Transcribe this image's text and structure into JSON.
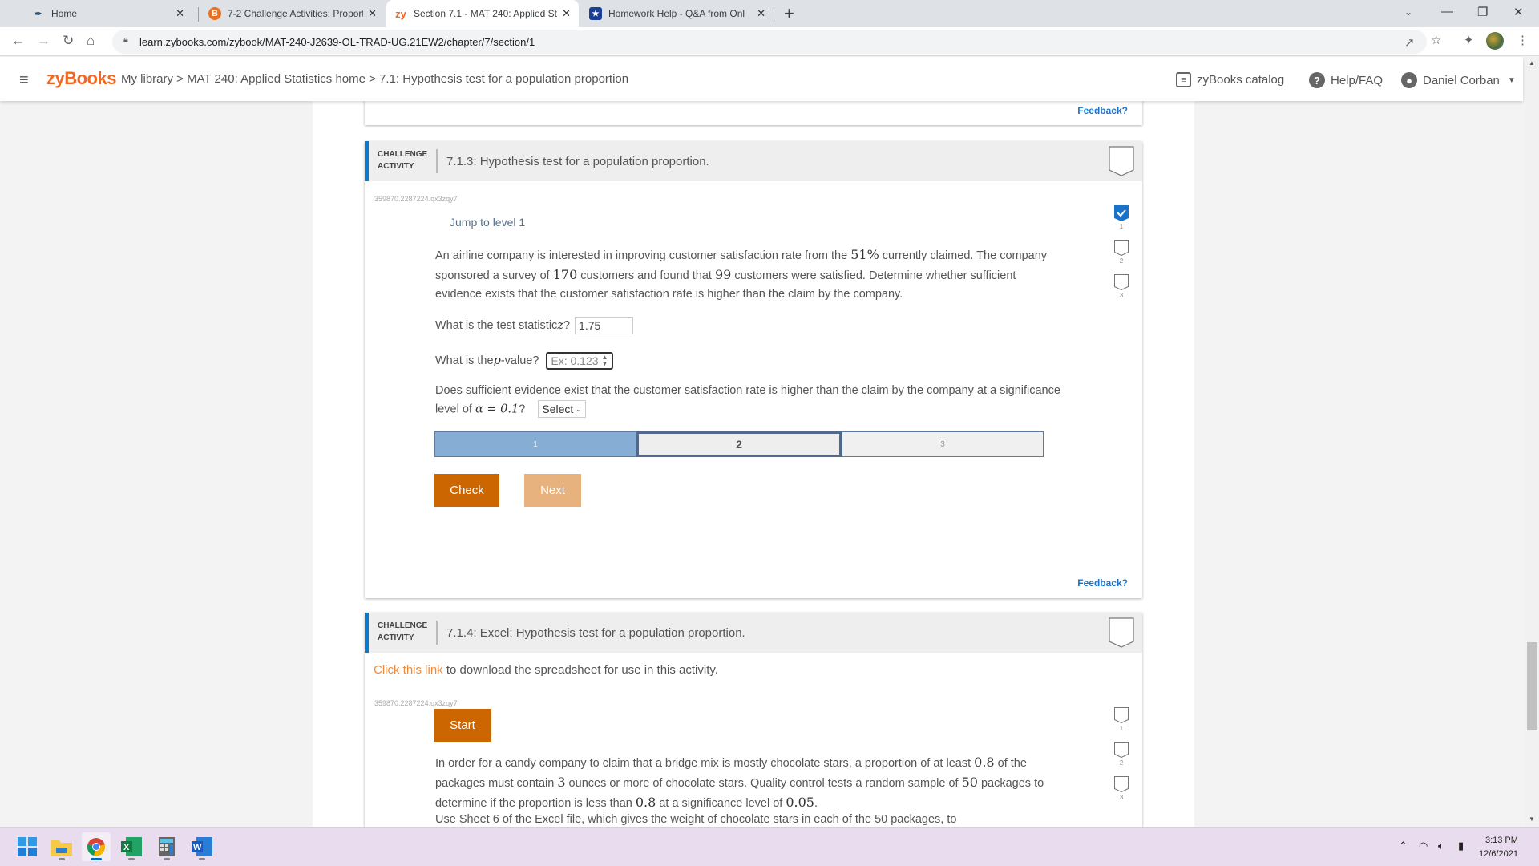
{
  "browser": {
    "tabs": [
      {
        "title": "Home",
        "favicon": "feather-icon",
        "active": false
      },
      {
        "title": "7-2 Challenge Activities: Proporti",
        "favicon": "b-brand-icon",
        "active": false
      },
      {
        "title": "Section 7.1 - MAT 240: Applied St",
        "favicon": "zy-icon",
        "active": true
      },
      {
        "title": "Homework Help - Q&A from Onl",
        "favicon": "shield-star-icon",
        "active": false
      }
    ],
    "new_tab_label": "+",
    "url": "learn.zybooks.com/zybook/MAT-240-J2639-OL-TRAD-UG.21EW2/chapter/7/section/1"
  },
  "header": {
    "logo": "zyBooks",
    "breadcrumb": "My library > MAT 240: Applied Statistics home > 7.1: Hypothesis test for a population proportion",
    "catalog_label": "zyBooks catalog",
    "help_label": "Help/FAQ",
    "user_name": "Daniel Corban"
  },
  "top_feedback": "Feedback?",
  "activity1": {
    "type_line1": "CHALLENGE",
    "type_line2": "ACTIVITY",
    "title": "7.1.3: Hypothesis test for a population proportion.",
    "id": "359870.2287224.qx3zqy7",
    "jump_label": "Jump to level 1",
    "prompt": {
      "p1": "An airline company is interested in improving customer satisfaction rate from the ",
      "n1": "51%",
      "p2": " currently claimed. The company sponsored a survey of ",
      "n2": "170",
      "p3": " customers and found that ",
      "n3": "99",
      "p4": " customers were satisfied. Determine whether sufficient evidence exists that the customer satisfaction rate is higher than the claim by the company."
    },
    "q1_label": "What is the test statistic ",
    "q1_var": "z",
    "q1_suffix": "?",
    "q1_value": "1.75",
    "q2_label": "What is the ",
    "q2_var": "p",
    "q2_suffix": "-value?",
    "q2_placeholder": "Ex: 0.123",
    "q3_text": "Does sufficient evidence exist that the customer satisfaction rate is higher than the claim by the company at a significance level of ",
    "q3_math": "α = 0.1",
    "q3_suffix": "?",
    "q3_select": "Select",
    "levels": [
      {
        "label": "1",
        "state": "done"
      },
      {
        "label": "2",
        "state": "current"
      },
      {
        "label": "3",
        "state": "todo"
      }
    ],
    "check_label": "Check",
    "next_label": "Next",
    "feedback": "Feedback?",
    "level_badges": [
      {
        "label": "1",
        "completed": true
      },
      {
        "label": "2",
        "completed": false
      },
      {
        "label": "3",
        "completed": false
      }
    ]
  },
  "activity2": {
    "type_line1": "CHALLENGE",
    "type_line2": "ACTIVITY",
    "title": "7.1.4: Excel: Hypothesis test for a population proportion.",
    "link_text": "Click this link",
    "link_suffix": " to download the spreadsheet for use in this activity.",
    "id": "359870.2287224.qx3zqy7",
    "start_label": "Start",
    "prompt": {
      "p1": "In order for a candy company to claim that a bridge mix is mostly chocolate stars, a proportion of at least ",
      "n1": "0.8",
      "p2": " of the packages must contain ",
      "n2": "3",
      "p3": " ounces or more of chocolate stars. Quality control tests a random sample of ",
      "n3": "50",
      "p4": " packages to determine if the proportion is less than ",
      "n4": "0.8",
      "p5": " at a significance level of ",
      "n5": "0.05",
      "p6": "."
    },
    "cutoff_text": "Use Sheet 6 of the Excel file, which gives the weight of chocolate stars in each of the 50 packages, to",
    "level_badges": [
      {
        "label": "1",
        "completed": false
      },
      {
        "label": "2",
        "completed": false
      },
      {
        "label": "3",
        "completed": false
      }
    ]
  },
  "taskbar": {
    "apps": [
      "windows-start",
      "file-explorer",
      "chrome",
      "excel",
      "calculator",
      "word"
    ],
    "time": "3:13 PM",
    "date": "12/6/2021"
  },
  "colors": {
    "brand_orange": "#f26722",
    "button_primary": "#cc6600",
    "button_disabled": "#e8b27f",
    "activity_accent": "#0a7ac9",
    "feedback_link": "#1a73c8",
    "level_done": "#86aed4"
  }
}
